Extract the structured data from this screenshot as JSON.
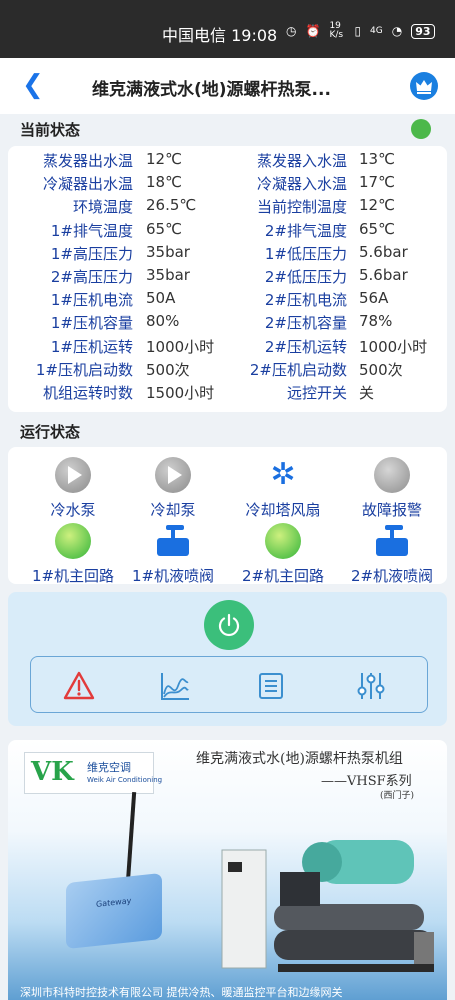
{
  "status_bar": {
    "carrier_time": "中国电信 19:08",
    "net_speed": "19 K/s",
    "network": "4G",
    "battery": "93"
  },
  "header": {
    "title": "维克满液式水(地)源螺杆热泵...",
    "back_icon": "back-icon",
    "crown_icon": "crown-icon"
  },
  "current_status": {
    "label": "当前状态",
    "rows": [
      {
        "k1": "蒸发器出水温",
        "v1": "12℃",
        "k2": "蒸发器入水温",
        "v2": "13℃"
      },
      {
        "k1": "冷凝器出水温",
        "v1": "18℃",
        "k2": "冷凝器入水温",
        "v2": "17℃"
      },
      {
        "k1": "环境温度",
        "v1": "26.5℃",
        "k2": "当前控制温度",
        "v2": "12℃"
      },
      {
        "k1": "1#排气温度",
        "v1": "65℃",
        "k2": "2#排气温度",
        "v2": "65℃"
      },
      {
        "k1": "1#高压压力",
        "v1": "35bar",
        "k2": "1#低压压力",
        "v2": "5.6bar"
      },
      {
        "k1": "2#高压压力",
        "v1": "35bar",
        "k2": "2#低压压力",
        "v2": "5.6bar"
      },
      {
        "k1": "1#压机电流",
        "v1": "50A",
        "k2": "2#压机电流",
        "v2": "56A"
      },
      {
        "k1": "1#压机容量",
        "v1": "80%",
        "k2": "2#压机容量",
        "v2": "78%"
      },
      {
        "k1": "1#压机运转",
        "v1": "1000小时",
        "k2": "2#压机运转",
        "v2": "1000小时"
      },
      {
        "k1": "1#压机启动数",
        "v1": "500次",
        "k2": "2#压机启动数",
        "v2": "500次"
      },
      {
        "k1": "机组运转时数",
        "v1": "1500小时",
        "k2": "远控开关",
        "v2": "关"
      }
    ]
  },
  "operation_status": {
    "label": "运行状态",
    "items": [
      {
        "label": "冷水泵",
        "icon": "pump-off-icon"
      },
      {
        "label": "冷却泵",
        "icon": "pump-off-icon"
      },
      {
        "label": "冷却塔风扇",
        "icon": "fan-icon"
      },
      {
        "label": "故障报警",
        "icon": "alarm-off-icon"
      },
      {
        "label": "1#机主回路",
        "icon": "circuit-on-icon"
      },
      {
        "label": "1#机液喷阀",
        "icon": "valve-icon"
      },
      {
        "label": "2#机主回路",
        "icon": "circuit-on-icon"
      },
      {
        "label": "2#机液喷阀",
        "icon": "valve-icon"
      }
    ]
  },
  "controls": {
    "power_icon": "power-icon",
    "tools": [
      "warning-icon",
      "chart-icon",
      "list-icon",
      "settings-icon"
    ]
  },
  "banner": {
    "logo_cn": "维克空调",
    "logo_en": "Weik Air Conditioning",
    "logo_mark": "VK",
    "title": "维克满液式水(地)源螺杆热泵机组",
    "subtitle": "——VHSF系列",
    "subtitle2": "(西门子)",
    "footer": "深圳市科特时控技术有限公司    提供冷热、暖通监控平台和边缘网关",
    "gateway_text": "Gateway"
  }
}
